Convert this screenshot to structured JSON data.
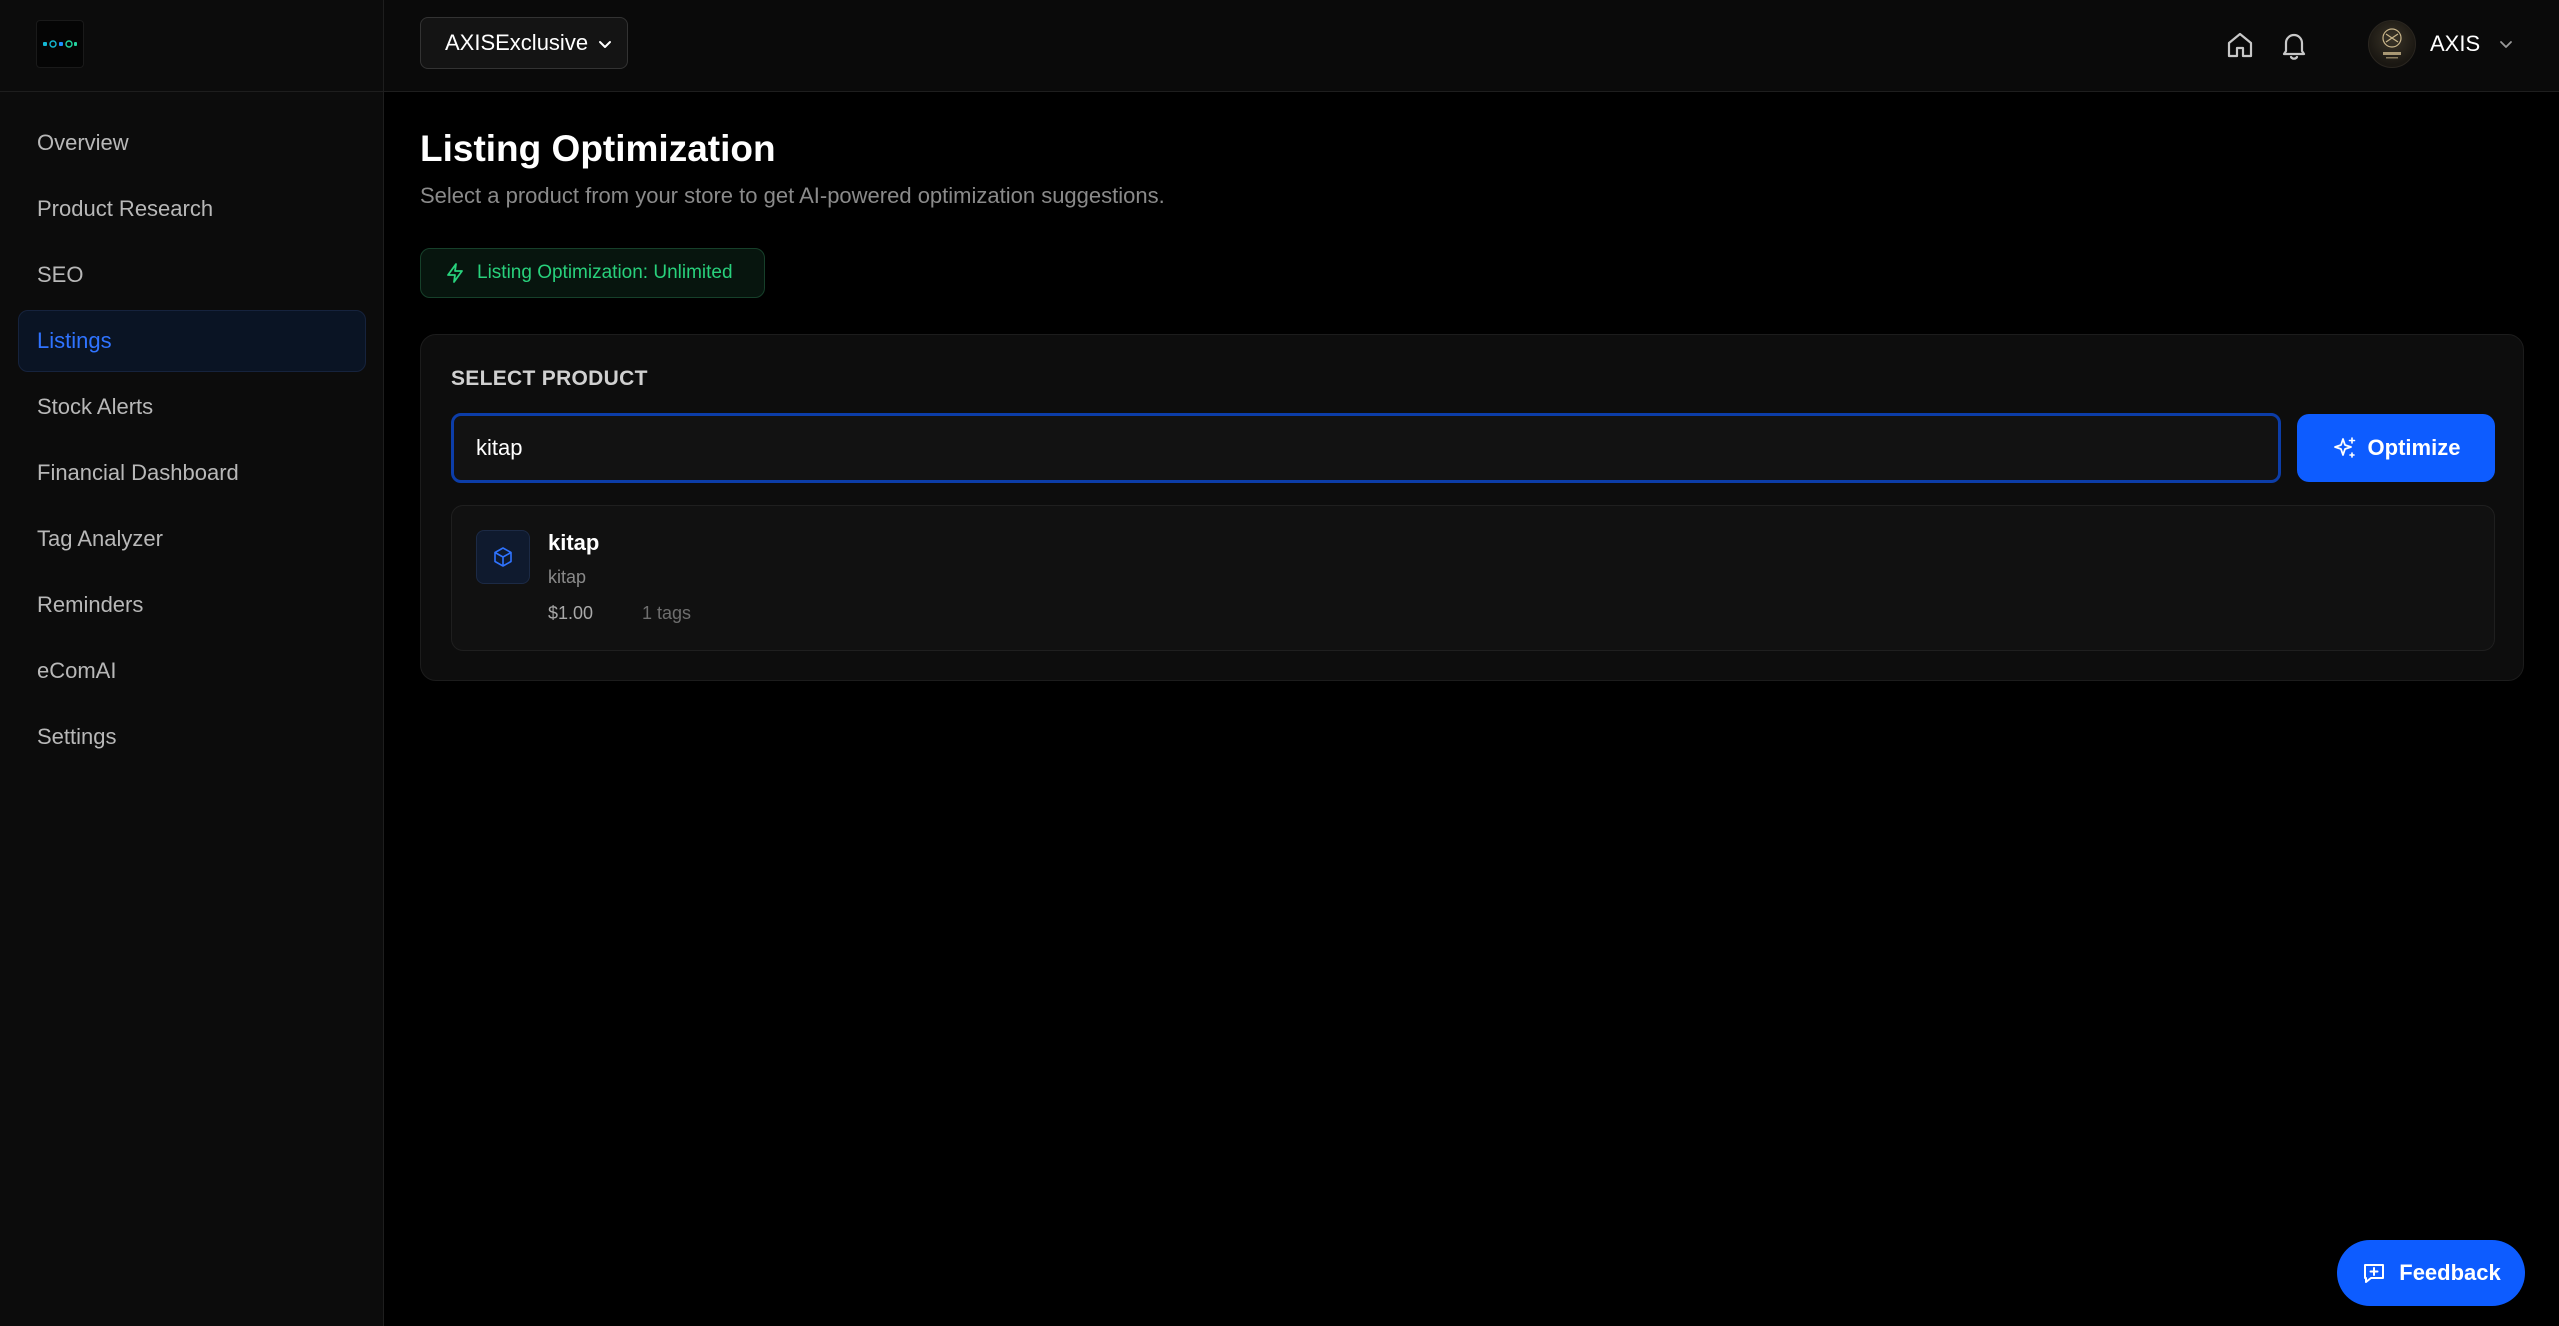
{
  "header": {
    "store_select": "AXISExclusive",
    "user_name": "AXIS"
  },
  "sidebar": {
    "items": [
      {
        "label": "Overview"
      },
      {
        "label": "Product Research"
      },
      {
        "label": "SEO"
      },
      {
        "label": "Listings",
        "active": true
      },
      {
        "label": "Stock Alerts"
      },
      {
        "label": "Financial Dashboard"
      },
      {
        "label": "Tag Analyzer"
      },
      {
        "label": "Reminders"
      },
      {
        "label": "eComAI"
      },
      {
        "label": "Settings"
      }
    ]
  },
  "main": {
    "title": "Listing Optimization",
    "subtitle": "Select a product from your store to get AI-powered optimization suggestions.",
    "badge": "Listing Optimization: Unlimited",
    "select_label": "SELECT PRODUCT",
    "search_value": "kitap",
    "optimize_label": "Optimize",
    "result": {
      "title": "kitap",
      "subtitle": "kitap",
      "price": "$1.00",
      "tags": "1 tags"
    }
  },
  "feedback_label": "Feedback",
  "colors": {
    "accent": "#0d5cff",
    "active_nav": "#2f73ff",
    "badge_green": "#28d17c",
    "background": "#000000"
  },
  "icons": [
    "logo",
    "chevron-down-icon",
    "home-icon",
    "bell-icon",
    "avatar",
    "zap-icon",
    "sparkles-icon",
    "box-icon",
    "message-plus-icon"
  ]
}
